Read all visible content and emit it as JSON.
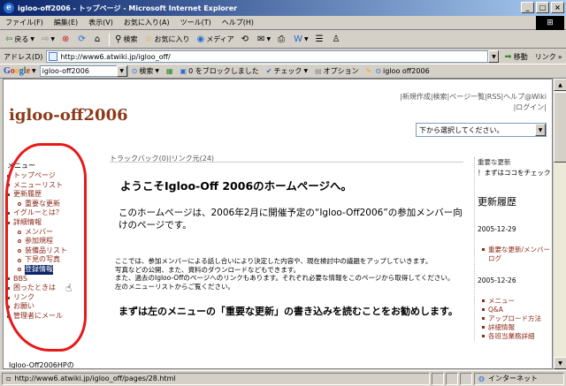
{
  "window": {
    "title": "igloo-off2006 - トップページ - Microsoft Internet Explorer"
  },
  "menubar": [
    "ファイル(F)",
    "編集(E)",
    "表示(V)",
    "お気に入り(A)",
    "ツール(T)",
    "ヘルプ(H)"
  ],
  "toolbar": {
    "back": "戻る",
    "search": "検索",
    "favorites": "お気に入り",
    "media": "メディア"
  },
  "address": {
    "label": "アドレス(D)",
    "url": "http://www6.atwiki.jp/igloo_off/",
    "go": "移動",
    "links": "リンク"
  },
  "googlebar": {
    "query": "igloo-off2006",
    "search": "検索",
    "blocked": "0 をブロックしました",
    "check": "チェック",
    "options": "オプション",
    "tag": "igloo off2006"
  },
  "page": {
    "toplinks_1": "|新規作成|検索|ページ一覧|RSS|ヘルプ@Wiki",
    "toplinks_2": "|ログイン|",
    "site_title": "igloo-off2006",
    "page_select": "下から選択してください。",
    "trackback": "トラックバック(0)|リンク元(24)"
  },
  "sidebar": {
    "heading": "メニュー",
    "items": [
      {
        "label": "トップページ",
        "sub": false
      },
      {
        "label": "メニューリスト",
        "sub": false
      },
      {
        "label": "更新履歴",
        "sub": false
      },
      {
        "label": "重要な更新",
        "sub": true
      },
      {
        "label": "イグルーとは？",
        "sub": false
      },
      {
        "label": "詳細情報",
        "sub": false
      },
      {
        "label": "メンバー",
        "sub": true
      },
      {
        "label": "参加規程",
        "sub": true
      },
      {
        "label": "装備品リスト",
        "sub": true
      },
      {
        "label": "下見の写真",
        "sub": true
      },
      {
        "label": "登録情報",
        "sub": true,
        "selected": true
      },
      {
        "label": "BBS",
        "sub": false
      },
      {
        "label": "困ったときは",
        "sub": false
      },
      {
        "label": "リンク",
        "sub": false
      },
      {
        "label": "お願い",
        "sub": false
      },
      {
        "label": "管理者にメール",
        "sub": false
      }
    ],
    "footer": "Igloo-Off2006HPの"
  },
  "main": {
    "welcome": "ようこそIgloo-Off 2006のホームページへ。",
    "intro": "このホームページは、2006年2月に開催予定の“Igloo-Off2006”の参加メンバー向けのページです。",
    "small_1": "ここでは、参加メンバーによる話し合いにより決定した内容や、現在検討中の議題をアップしていきます。",
    "small_2": "写真などの公開、また、資料のダウンロードなどもできます。",
    "small_3": "また、過去のIgloo-Offのページへのリンクもあります。それぞれ必要な情報をこのページから取得してください。",
    "small_4": "左のメニューリストからご覧ください。",
    "readme": "まずは左のメニューの「重要な更新」の書き込みを読むことをお勧めします。"
  },
  "rightcol": {
    "heading": "重要な更新",
    "notice": "！まずはココをチェック",
    "title": "更新履歴",
    "date1": "2005-12-29",
    "list1": [
      "重要な更新/メンバーログ"
    ],
    "date2": "2005-12-26",
    "list2": [
      "メニュー",
      "Q&A",
      "アップロード方法",
      "詳細情報",
      "各班当業務詳細"
    ]
  },
  "status": {
    "text": "http://www6.atwiki.jp/igloo_off/pages/28.html",
    "zone": "インターネット"
  }
}
